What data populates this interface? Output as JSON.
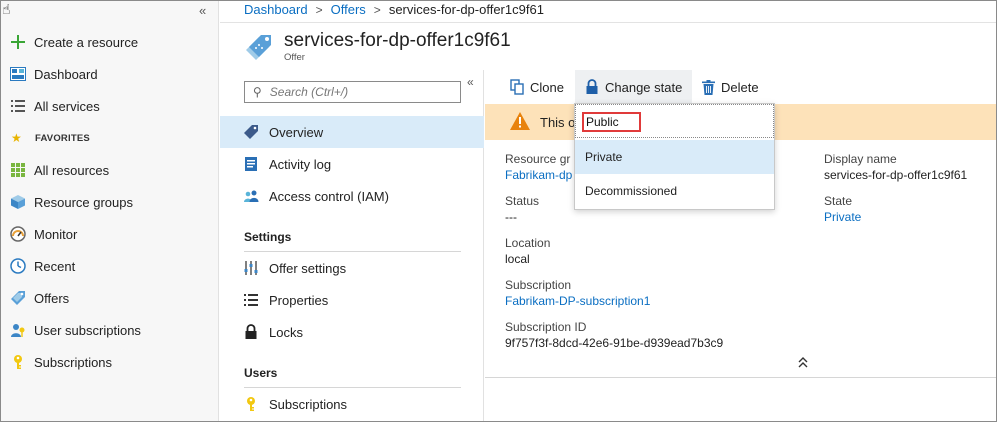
{
  "breadcrumb": {
    "items": [
      "Dashboard",
      "Offers"
    ],
    "separator": ">",
    "current": "services-for-dp-offer1c9f61"
  },
  "header": {
    "title": "services-for-dp-offer1c9f61",
    "subtitle": "Offer"
  },
  "leftnav": {
    "collapse_glyph": "«",
    "items": [
      {
        "label": "Create a resource",
        "icon": "plus-icon"
      },
      {
        "label": "Dashboard",
        "icon": "dashboard-icon"
      },
      {
        "label": "All services",
        "icon": "list-icon"
      }
    ],
    "favorites_header": "FAVORITES",
    "favorites": [
      {
        "label": "All resources",
        "icon": "grid-icon"
      },
      {
        "label": "Resource groups",
        "icon": "cube-icon"
      },
      {
        "label": "Monitor",
        "icon": "gauge-icon"
      },
      {
        "label": "Recent",
        "icon": "clock-icon"
      },
      {
        "label": "Offers",
        "icon": "tag-icon"
      },
      {
        "label": "User subscriptions",
        "icon": "user-key-icon"
      },
      {
        "label": "Subscriptions",
        "icon": "key-icon"
      }
    ]
  },
  "resmenu": {
    "search_placeholder": "Search (Ctrl+/)",
    "collapse_glyph": "«",
    "items": [
      {
        "label": "Overview",
        "icon": "tag-icon"
      },
      {
        "label": "Activity log",
        "icon": "log-icon"
      },
      {
        "label": "Access control (IAM)",
        "icon": "people-icon"
      }
    ],
    "settings_header": "Settings",
    "settings": [
      {
        "label": "Offer settings",
        "icon": "sliders-icon"
      },
      {
        "label": "Properties",
        "icon": "properties-icon"
      },
      {
        "label": "Locks",
        "icon": "lock-icon"
      }
    ],
    "users_header": "Users",
    "users": [
      {
        "label": "Subscriptions",
        "icon": "key-icon"
      }
    ]
  },
  "toolbar": {
    "clone": "Clone",
    "change_state": "Change state",
    "delete": "Delete"
  },
  "warning": {
    "text": "This of"
  },
  "dropdown": {
    "selected": "Public",
    "options": [
      "Private",
      "Decommissioned"
    ]
  },
  "properties": {
    "resource_group_label": "Resource gr",
    "resource_group_value": "Fabrikam-dp",
    "status_label": "Status",
    "status_value": "---",
    "location_label": "Location",
    "location_value": "local",
    "subscription_label": "Subscription",
    "subscription_value": "Fabrikam-DP-subscription1",
    "subscription_id_label": "Subscription ID",
    "subscription_id_value": "9f757f3f-8dcd-42e6-91be-d939ead7b3c9",
    "display_name_label": "Display name",
    "display_name_value": "services-for-dp-offer1c9f61",
    "state_label": "State",
    "state_value": "Private"
  },
  "colors": {
    "link": "#0a6ec2",
    "active_bg": "#d9ebf9",
    "warning_bg": "#fde2b9",
    "highlight_border": "#e03a3a"
  }
}
